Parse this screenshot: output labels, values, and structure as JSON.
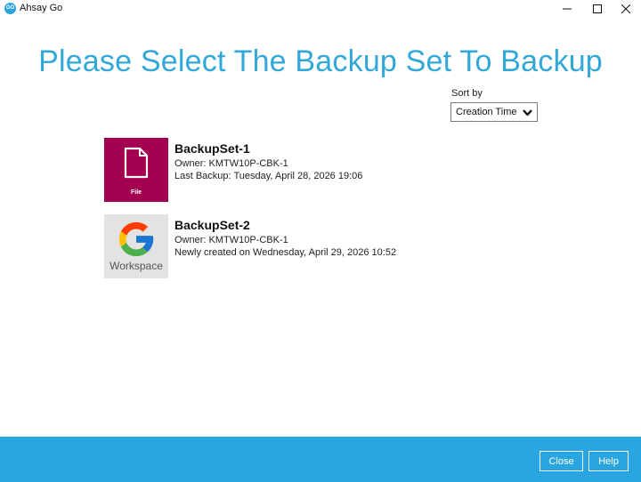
{
  "window": {
    "app_icon_text": "GO",
    "title": "Ahsay Go",
    "icons": [
      "minimize-icon",
      "maximize-icon",
      "close-icon"
    ]
  },
  "page": {
    "heading": "Please Select The Backup Set To Backup"
  },
  "sort": {
    "label": "Sort by",
    "selected": "Creation Time",
    "icon": "chevron-down-icon"
  },
  "backup_sets": [
    {
      "name": "BackupSet-1",
      "owner": "Owner: KMTW10P-CBK-1",
      "status": "Last Backup: Tuesday, April 28, 2026 19:06",
      "thumb_label": "File",
      "thumb_color": "#a3004f",
      "icon": "file-icon"
    },
    {
      "name": "BackupSet-2",
      "owner": "Owner: KMTW10P-CBK-1",
      "status": "Newly created on Wednesday, April 29, 2026 10:52",
      "thumb_label": "Workspace",
      "thumb_color": "#e3e3e3",
      "icon": "google-g-icon"
    }
  ],
  "footer": {
    "close_label": "Close",
    "help_label": "Help",
    "background": "#29a6e0"
  },
  "colors": {
    "accent": "#32a8d8"
  }
}
